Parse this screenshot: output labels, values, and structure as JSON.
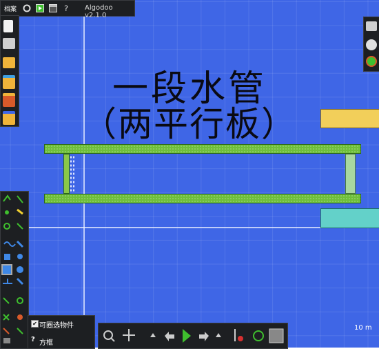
{
  "app": {
    "menu_label": "档案",
    "version": "Algodoo v2.1.0",
    "help_glyph": "?"
  },
  "canvas": {
    "title_line1": "一段水管",
    "title_line2": "（两平行板）",
    "scale_label": "10 m"
  },
  "bottom_left_panel": {
    "checkbox_label": "可圈选物件",
    "checkbox_checked": true,
    "help_glyph": "?",
    "box_label": "方框"
  },
  "colors": {
    "background": "#3f66e6",
    "plate": "#6ebf3a",
    "yellow_block": "#f2cf5a",
    "cyan_block": "#63d1c9",
    "end_cap": "#a8d8a0",
    "toolbar": "#1d1f22",
    "play": "#3fbf2e"
  },
  "icons": {
    "top": [
      "gear-icon",
      "play-icon",
      "window-icon",
      "help-icon"
    ],
    "sidebar": [
      "new-file-icon",
      "printer-icon",
      "open-folder-icon",
      "save-icon",
      "load-scene-icon",
      "export-icon"
    ],
    "bottom": [
      "zoom-icon",
      "move-icon",
      "undo-icon",
      "play-icon",
      "redo-icon",
      "gravity-icon",
      "air-icon",
      "grid-icon"
    ]
  }
}
